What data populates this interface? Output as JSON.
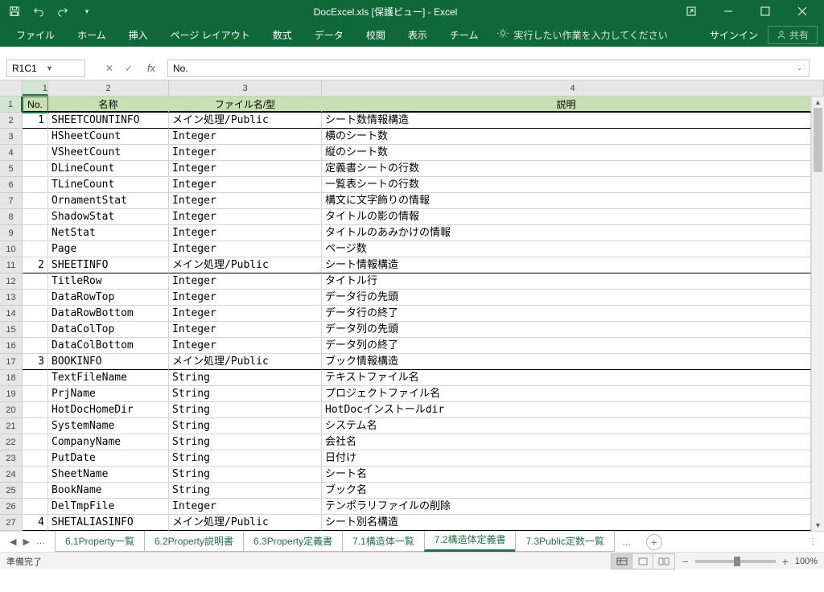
{
  "titlebar": {
    "title": "DocExcel.xls [保護ビュー] - Excel"
  },
  "ribbon": {
    "tabs": [
      "ファイル",
      "ホーム",
      "挿入",
      "ページ レイアウト",
      "数式",
      "データ",
      "校閲",
      "表示",
      "チーム"
    ],
    "tellme": "実行したい作業を入力してください",
    "signin": "サインイン",
    "share": "共有"
  },
  "namebox": "R1C1",
  "fx_value": "No.",
  "col_headers": [
    "1",
    "2",
    "3",
    "4"
  ],
  "table_headers": [
    "No.",
    "名称",
    "ファイル名/型",
    "説明"
  ],
  "rows": [
    {
      "n": "1",
      "a": "1",
      "b": "SHEETCOUNTINFO",
      "c": "メイン処理/Public",
      "d": "シート数情報構造",
      "group": true
    },
    {
      "n": "2",
      "a": "",
      "b": "HSheetCount",
      "c": "Integer",
      "d": "横のシート数"
    },
    {
      "n": "3",
      "a": "",
      "b": "VSheetCount",
      "c": "Integer",
      "d": "縦のシート数"
    },
    {
      "n": "4",
      "a": "",
      "b": "DLineCount",
      "c": "Integer",
      "d": "定義書シートの行数"
    },
    {
      "n": "5",
      "a": "",
      "b": "TLineCount",
      "c": "Integer",
      "d": "一覧表シートの行数"
    },
    {
      "n": "6",
      "a": "",
      "b": "OrnamentStat",
      "c": "Integer",
      "d": "構文に文字飾りの情報"
    },
    {
      "n": "7",
      "a": "",
      "b": "ShadowStat",
      "c": "Integer",
      "d": "タイトルの影の情報"
    },
    {
      "n": "8",
      "a": "",
      "b": "NetStat",
      "c": "Integer",
      "d": "タイトルのあみかけの情報"
    },
    {
      "n": "9",
      "a": "",
      "b": "Page",
      "c": "Integer",
      "d": "ページ数"
    },
    {
      "n": "10",
      "a": "2",
      "b": "SHEETINFO",
      "c": "メイン処理/Public",
      "d": "シート情報構造",
      "group": true
    },
    {
      "n": "11",
      "a": "",
      "b": "TitleRow",
      "c": "Integer",
      "d": "タイトル行"
    },
    {
      "n": "12",
      "a": "",
      "b": "DataRowTop",
      "c": "Integer",
      "d": "データ行の先頭"
    },
    {
      "n": "13",
      "a": "",
      "b": "DataRowBottom",
      "c": "Integer",
      "d": "データ行の終了"
    },
    {
      "n": "14",
      "a": "",
      "b": "DataColTop",
      "c": "Integer",
      "d": "データ列の先頭"
    },
    {
      "n": "15",
      "a": "",
      "b": "DataColBottom",
      "c": "Integer",
      "d": "データ列の終了"
    },
    {
      "n": "16",
      "a": "3",
      "b": "BOOKINFO",
      "c": "メイン処理/Public",
      "d": "ブック情報構造",
      "group": true
    },
    {
      "n": "17",
      "a": "",
      "b": "TextFileName",
      "c": "String",
      "d": "テキストファイル名"
    },
    {
      "n": "18",
      "a": "",
      "b": "PrjName",
      "c": "String",
      "d": "プロジェクトファイル名"
    },
    {
      "n": "19",
      "a": "",
      "b": "HotDocHomeDir",
      "c": "String",
      "d": "HotDocインストールdir"
    },
    {
      "n": "20",
      "a": "",
      "b": "SystemName",
      "c": "String",
      "d": "システム名"
    },
    {
      "n": "21",
      "a": "",
      "b": "CompanyName",
      "c": "String",
      "d": "会社名"
    },
    {
      "n": "22",
      "a": "",
      "b": "PutDate",
      "c": "String",
      "d": "日付け"
    },
    {
      "n": "23",
      "a": "",
      "b": "SheetName",
      "c": "String",
      "d": "シート名"
    },
    {
      "n": "24",
      "a": "",
      "b": "BookName",
      "c": "String",
      "d": "ブック名"
    },
    {
      "n": "25",
      "a": "",
      "b": "DelTmpFile",
      "c": "Integer",
      "d": "テンポラリファイルの削除"
    },
    {
      "n": "26",
      "a": "4",
      "b": "SHETALIASINFO",
      "c": "メイン処理/Public",
      "d": "シート別名構造",
      "group": true
    }
  ],
  "sheets": [
    "6.1Property一覧",
    "6.2Property説明書",
    "6.3Property定義書",
    "7.1構造体一覧",
    "7.2構造体定義書",
    "7.3Public定数一覧"
  ],
  "active_sheet": 4,
  "status": "準備完了",
  "zoom": "100%"
}
